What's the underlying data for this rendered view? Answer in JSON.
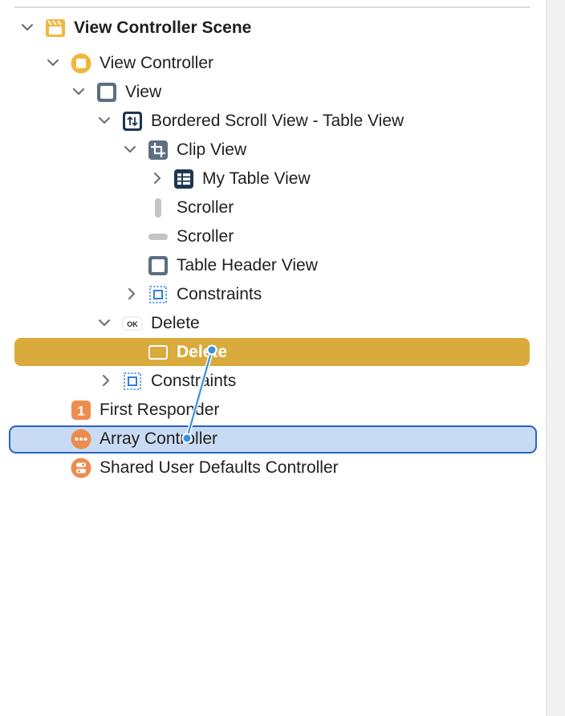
{
  "outline": {
    "items": [
      {
        "label": "View Controller Scene",
        "icon": "scene-icon",
        "expanded": true,
        "bold": true
      },
      {
        "label": "View Controller",
        "icon": "view-controller-icon",
        "expanded": true
      },
      {
        "label": "View",
        "icon": "view-icon",
        "expanded": true
      },
      {
        "label": "Bordered Scroll View - Table View",
        "icon": "scroll-view-icon",
        "expanded": true
      },
      {
        "label": "Clip View",
        "icon": "clip-view-icon",
        "expanded": true
      },
      {
        "label": "My Table View",
        "icon": "table-view-icon",
        "expanded": false
      },
      {
        "label": "Scroller",
        "icon": "vertical-scroller-icon"
      },
      {
        "label": "Scroller",
        "icon": "horizontal-scroller-icon"
      },
      {
        "label": "Table Header View",
        "icon": "table-header-view-icon"
      },
      {
        "label": "Constraints",
        "icon": "constraints-icon",
        "expanded": false
      },
      {
        "label": "Delete",
        "icon": "button-icon",
        "icon_text": "OK",
        "expanded": true
      },
      {
        "label": "Delete",
        "icon": "button-cell-icon",
        "selected": true
      },
      {
        "label": "Constraints",
        "icon": "constraints-icon",
        "expanded": false
      },
      {
        "label": "First Responder",
        "icon": "first-responder-icon",
        "icon_text": "1"
      },
      {
        "label": "Array Controller",
        "icon": "array-controller-icon",
        "drop_target": true
      },
      {
        "label": "Shared User Defaults Controller",
        "icon": "user-defaults-controller-icon"
      }
    ]
  },
  "colors": {
    "selection": "#d9ab3d",
    "drop_target_fill": "#c9dbf4",
    "drop_target_border": "#2a63c3",
    "connection_line": "#3b8fe0",
    "orange": "#ee8c4f",
    "yellow": "#f0b73c",
    "navy": "#1d3550",
    "slate": "#5e6e82"
  }
}
